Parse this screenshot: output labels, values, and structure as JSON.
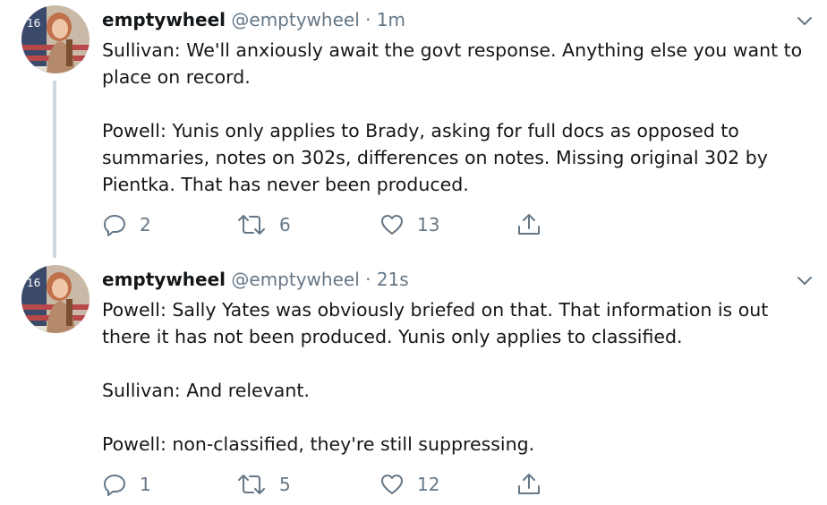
{
  "colors": {
    "text_primary": "#14171a",
    "text_secondary": "#657786",
    "thread_line": "#ccd6dd"
  },
  "tweets": [
    {
      "name": "emptywheel",
      "handle": "@emptywheel",
      "separator": "·",
      "time": "1m",
      "paragraphs": [
        "Sullivan: We'll anxiously await the govt response. Anything else you want to place on record.",
        "Powell: Yunis only applies to Brady, asking for full docs as opposed to summaries, notes on 302s, differences on notes. Missing original 302 by Pientka. That has never been produced."
      ],
      "replies": "2",
      "retweets": "6",
      "likes": "13",
      "icons": [
        "reply-icon",
        "retweet-icon",
        "like-icon",
        "share-icon",
        "chevron-down-icon"
      ]
    },
    {
      "name": "emptywheel",
      "handle": "@emptywheel",
      "separator": "·",
      "time": "21s",
      "paragraphs": [
        "Powell: Sally Yates was obviously briefed on that. That information is out there it has not been produced. Yunis only applies to classified.",
        "Sullivan: And relevant.",
        "Powell: non-classified, they're still suppressing."
      ],
      "replies": "1",
      "retweets": "5",
      "likes": "12",
      "icons": [
        "reply-icon",
        "retweet-icon",
        "like-icon",
        "share-icon",
        "chevron-down-icon"
      ]
    }
  ]
}
